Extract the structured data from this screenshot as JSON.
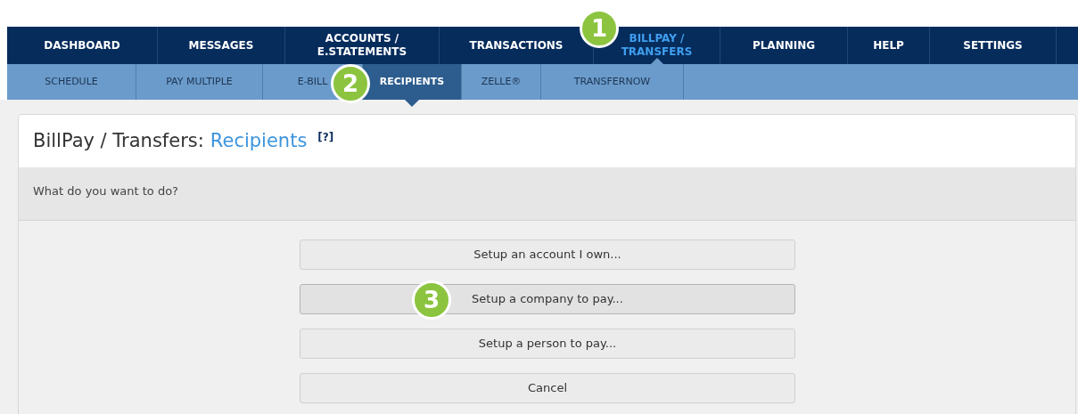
{
  "main_nav": [
    {
      "label": "DASHBOARD",
      "selected": false
    },
    {
      "label": "MESSAGES",
      "selected": false
    },
    {
      "label": "ACCOUNTS / E.STATEMENTS",
      "selected": false
    },
    {
      "label": "TRANSACTIONS",
      "selected": false
    },
    {
      "label": "BILLPAY / TRANSFERS",
      "selected": true
    },
    {
      "label": "PLANNING",
      "selected": false
    },
    {
      "label": "HELP",
      "selected": false
    },
    {
      "label": "SETTINGS",
      "selected": false
    }
  ],
  "sub_nav": [
    {
      "label": "SCHEDULE",
      "selected": false
    },
    {
      "label": "PAY MULTIPLE",
      "selected": false
    },
    {
      "label": "E-BILL",
      "selected": false
    },
    {
      "label": "RECIPIENTS",
      "selected": true
    },
    {
      "label": "ZELLE®",
      "selected": false
    },
    {
      "label": "TRANSFERNOW",
      "selected": false
    }
  ],
  "panel": {
    "title": "BillPay / Transfers:",
    "title_highlight": "Recipients",
    "help": "[?]",
    "prompt": "What do you want to do?",
    "buttons": [
      {
        "label": "Setup an account I own...",
        "highlighted": false
      },
      {
        "label": "Setup a company to pay...",
        "highlighted": true
      },
      {
        "label": "Setup a person to pay...",
        "highlighted": false
      },
      {
        "label": "Cancel",
        "highlighted": false
      }
    ]
  },
  "callouts": [
    "1",
    "2",
    "3"
  ]
}
